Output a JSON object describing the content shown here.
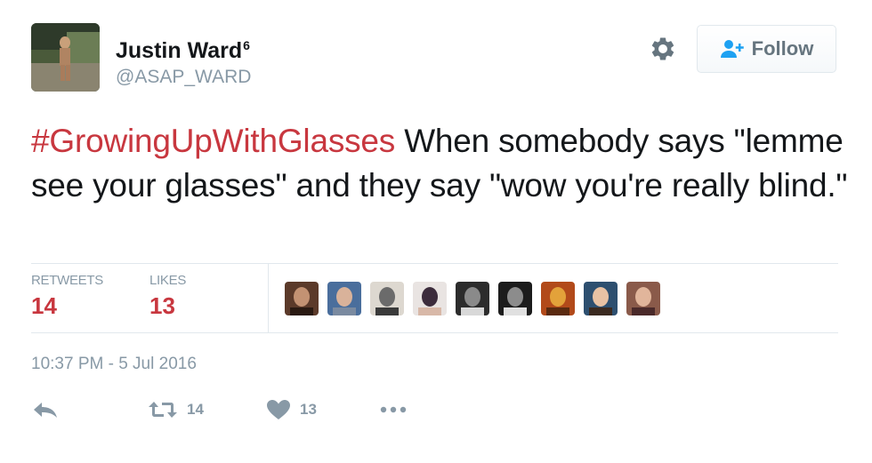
{
  "user": {
    "display_name": "Justin Ward",
    "badge": "6",
    "handle": "@ASAP_WARD"
  },
  "header": {
    "follow_label": "Follow",
    "gear_icon": "gear-icon",
    "follow_icon": "add-user-icon"
  },
  "tweet": {
    "hashtag": "#GrowingUpWithGlasses",
    "body": " When somebody says \"lemme see your glasses\" and they say \"wow you're really blind.\""
  },
  "stats": {
    "retweets_label": "RETWEETS",
    "retweets_value": "14",
    "likes_label": "LIKES",
    "likes_value": "13",
    "liker_count": 9
  },
  "timestamp": "10:37 PM - 5 Jul 2016",
  "actions": {
    "reply_icon": "reply-icon",
    "retweet_icon": "retweet-icon",
    "retweet_count": "14",
    "like_icon": "heart-icon",
    "like_count": "13",
    "more_icon": "more-icon"
  },
  "colors": {
    "hashtag": "#c8373f",
    "stat_value": "#c8373f",
    "muted": "#8899a6",
    "text": "#14171a",
    "border": "#e1e8ed"
  }
}
